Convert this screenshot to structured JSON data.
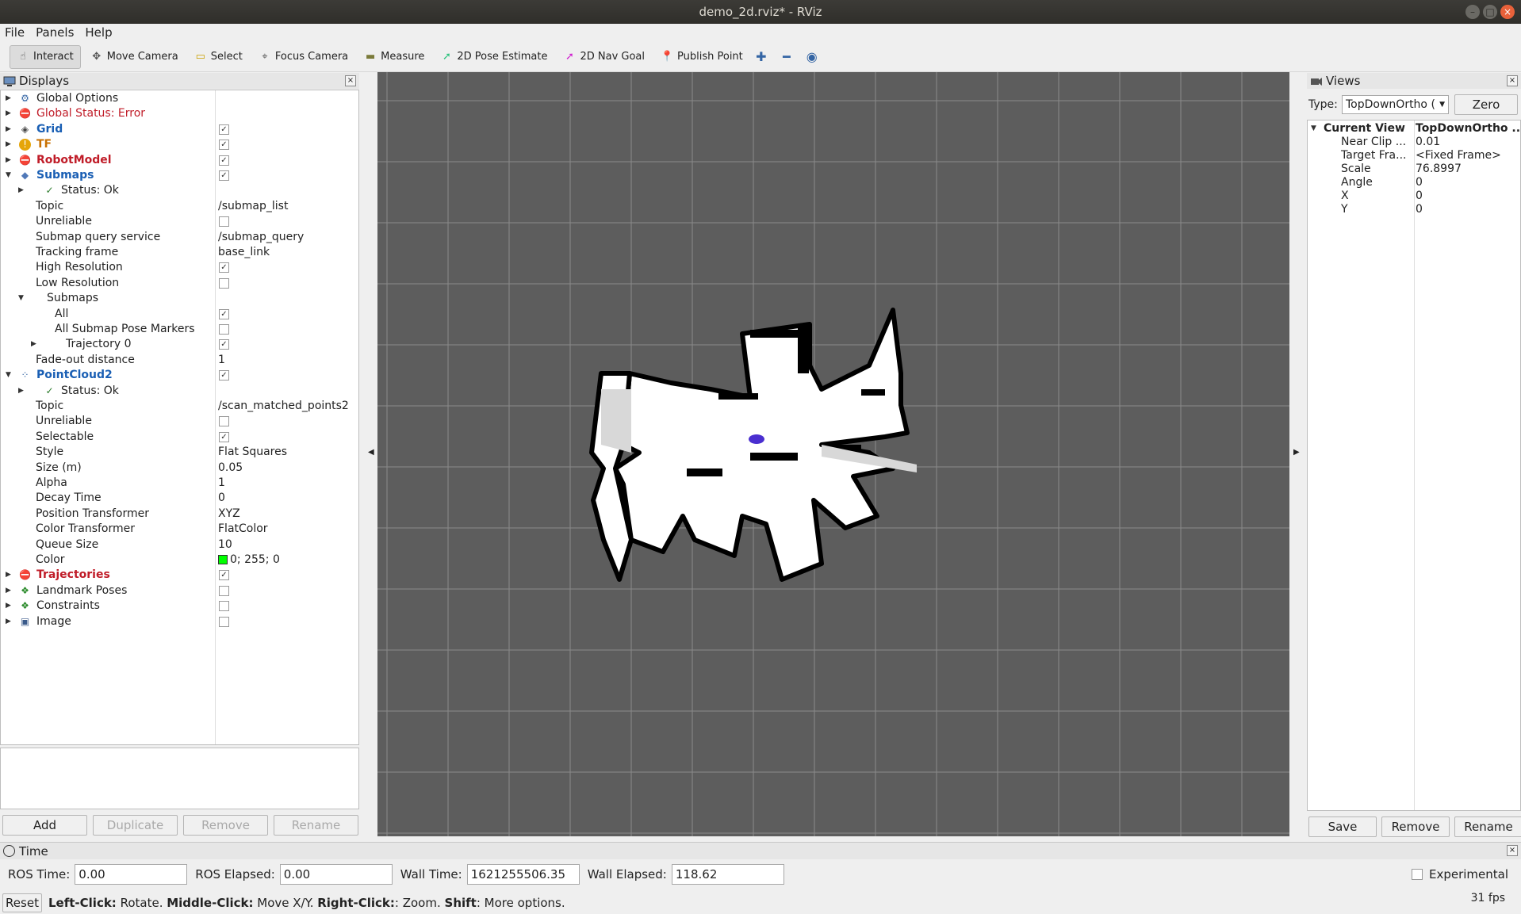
{
  "window": {
    "title": "demo_2d.rviz* - RViz"
  },
  "menu": [
    "File",
    "Panels",
    "Help"
  ],
  "toolbar": [
    {
      "label": "Interact",
      "icon": "hand-icon",
      "active": true
    },
    {
      "label": "Move Camera",
      "icon": "move-camera-icon"
    },
    {
      "label": "Select",
      "icon": "select-icon"
    },
    {
      "label": "Focus Camera",
      "icon": "focus-camera-icon"
    },
    {
      "label": "Measure",
      "icon": "ruler-icon"
    },
    {
      "label": "2D Pose Estimate",
      "icon": "green-arrow-icon"
    },
    {
      "label": "2D Nav Goal",
      "icon": "magenta-arrow-icon"
    },
    {
      "label": "Publish Point",
      "icon": "pin-icon"
    }
  ],
  "toolbar_extra": [
    "plus-icon",
    "minus-icon",
    "eye-icon"
  ],
  "displays": {
    "title": "Displays",
    "rows": [
      {
        "label": "Global Options",
        "depth": 0,
        "arrow": "right",
        "icon": "gear-icon",
        "style": ""
      },
      {
        "label": "Global Status: Error",
        "depth": 0,
        "arrow": "right",
        "icon": "error-icon",
        "style": "err"
      },
      {
        "label": "Grid",
        "depth": 0,
        "arrow": "right",
        "icon": "grid-icon",
        "style": "blue",
        "check": true
      },
      {
        "label": "TF",
        "depth": 0,
        "arrow": "right",
        "icon": "warning-icon",
        "style": "orange",
        "check": true
      },
      {
        "label": "RobotModel",
        "depth": 0,
        "arrow": "right",
        "icon": "error-icon",
        "style": "red",
        "check": true
      },
      {
        "label": "Submaps",
        "depth": 0,
        "arrow": "down",
        "icon": "diamond-icon",
        "style": "blue",
        "check": true
      },
      {
        "label": "Status: Ok",
        "depth": 1,
        "arrow": "right",
        "icon": "checkmark-icon",
        "style": ""
      },
      {
        "label": "Topic",
        "depth": 1,
        "value": "/submap_list"
      },
      {
        "label": "Unreliable",
        "depth": 1,
        "check": false
      },
      {
        "label": "Submap query service",
        "depth": 1,
        "value": "/submap_query"
      },
      {
        "label": "Tracking frame",
        "depth": 1,
        "value": "base_link"
      },
      {
        "label": "High Resolution",
        "depth": 1,
        "check": true
      },
      {
        "label": "Low Resolution",
        "depth": 1,
        "check": false
      },
      {
        "label": "Submaps",
        "depth": 1,
        "arrow": "down"
      },
      {
        "label": "All",
        "depth": 2,
        "check": true
      },
      {
        "label": "All Submap Pose Markers",
        "depth": 2,
        "check": false
      },
      {
        "label": "Trajectory 0",
        "depth": 2,
        "arrow": "right",
        "check": true
      },
      {
        "label": "Fade-out distance",
        "depth": 1,
        "value": "1"
      },
      {
        "label": "PointCloud2",
        "depth": 0,
        "arrow": "down",
        "icon": "pointcloud-icon",
        "style": "blue",
        "check": true
      },
      {
        "label": "Status: Ok",
        "depth": 1,
        "arrow": "right",
        "icon": "checkmark-icon",
        "style": ""
      },
      {
        "label": "Topic",
        "depth": 1,
        "value": "/scan_matched_points2"
      },
      {
        "label": "Unreliable",
        "depth": 1,
        "check": false
      },
      {
        "label": "Selectable",
        "depth": 1,
        "check": true
      },
      {
        "label": "Style",
        "depth": 1,
        "value": "Flat Squares"
      },
      {
        "label": "Size (m)",
        "depth": 1,
        "value": "0.05"
      },
      {
        "label": "Alpha",
        "depth": 1,
        "value": "1"
      },
      {
        "label": "Decay Time",
        "depth": 1,
        "value": "0"
      },
      {
        "label": "Position Transformer",
        "depth": 1,
        "value": "XYZ"
      },
      {
        "label": "Color Transformer",
        "depth": 1,
        "value": "FlatColor"
      },
      {
        "label": "Queue Size",
        "depth": 1,
        "value": "10"
      },
      {
        "label": "Color",
        "depth": 1,
        "value": "0; 255; 0",
        "swatch": "#00ff00"
      },
      {
        "label": "Trajectories",
        "depth": 0,
        "arrow": "right",
        "icon": "error-icon",
        "style": "red",
        "check": true
      },
      {
        "label": "Landmark Poses",
        "depth": 0,
        "arrow": "right",
        "icon": "markers-icon",
        "style": "",
        "check": false
      },
      {
        "label": "Constraints",
        "depth": 0,
        "arrow": "right",
        "icon": "markers-icon",
        "style": "",
        "check": false
      },
      {
        "label": "Image",
        "depth": 0,
        "arrow": "right",
        "icon": "image-icon",
        "style": "",
        "check": false
      }
    ],
    "buttons": [
      {
        "label": "Add",
        "enabled": true
      },
      {
        "label": "Duplicate",
        "enabled": false
      },
      {
        "label": "Remove",
        "enabled": false
      },
      {
        "label": "Rename",
        "enabled": false
      }
    ]
  },
  "views": {
    "title": "Views",
    "type_label": "Type:",
    "type_value": "TopDownOrtho (",
    "zero_label": "Zero",
    "current_view": {
      "label": "Current View",
      "value": "TopDownOrtho ..."
    },
    "props": [
      {
        "label": "Near Clip ...",
        "value": "0.01"
      },
      {
        "label": "Target Fra...",
        "value": "<Fixed Frame>"
      },
      {
        "label": "Scale",
        "value": "76.8997"
      },
      {
        "label": "Angle",
        "value": "0"
      },
      {
        "label": "X",
        "value": "0"
      },
      {
        "label": "Y",
        "value": "0"
      }
    ],
    "buttons": [
      "Save",
      "Remove",
      "Rename"
    ]
  },
  "time": {
    "title": "Time",
    "ros_time_label": "ROS Time:",
    "ros_time": "0.00",
    "ros_elapsed_label": "ROS Elapsed:",
    "ros_elapsed": "0.00",
    "wall_time_label": "Wall Time:",
    "wall_time": "1621255506.35",
    "wall_elapsed_label": "Wall Elapsed:",
    "wall_elapsed": "118.62",
    "experimental_label": "Experimental"
  },
  "status": {
    "reset_label": "Reset",
    "hints": [
      {
        "key": "Left-Click:",
        "text": " Rotate. "
      },
      {
        "key": "Middle-Click:",
        "text": " Move X/Y. "
      },
      {
        "key": "Right-Click:",
        "text": ": Zoom. "
      },
      {
        "key": "Shift",
        "text": ": More options."
      }
    ],
    "fps": "31 fps"
  },
  "colors": {
    "viewport_bg": "#5d5d5d",
    "grid": "#8a8a8a",
    "map_free": "#ffffff",
    "map_wall": "#000000",
    "robot": "#4a2fd0",
    "error": "#c01c28",
    "link_blue": "#1a5fb4"
  }
}
